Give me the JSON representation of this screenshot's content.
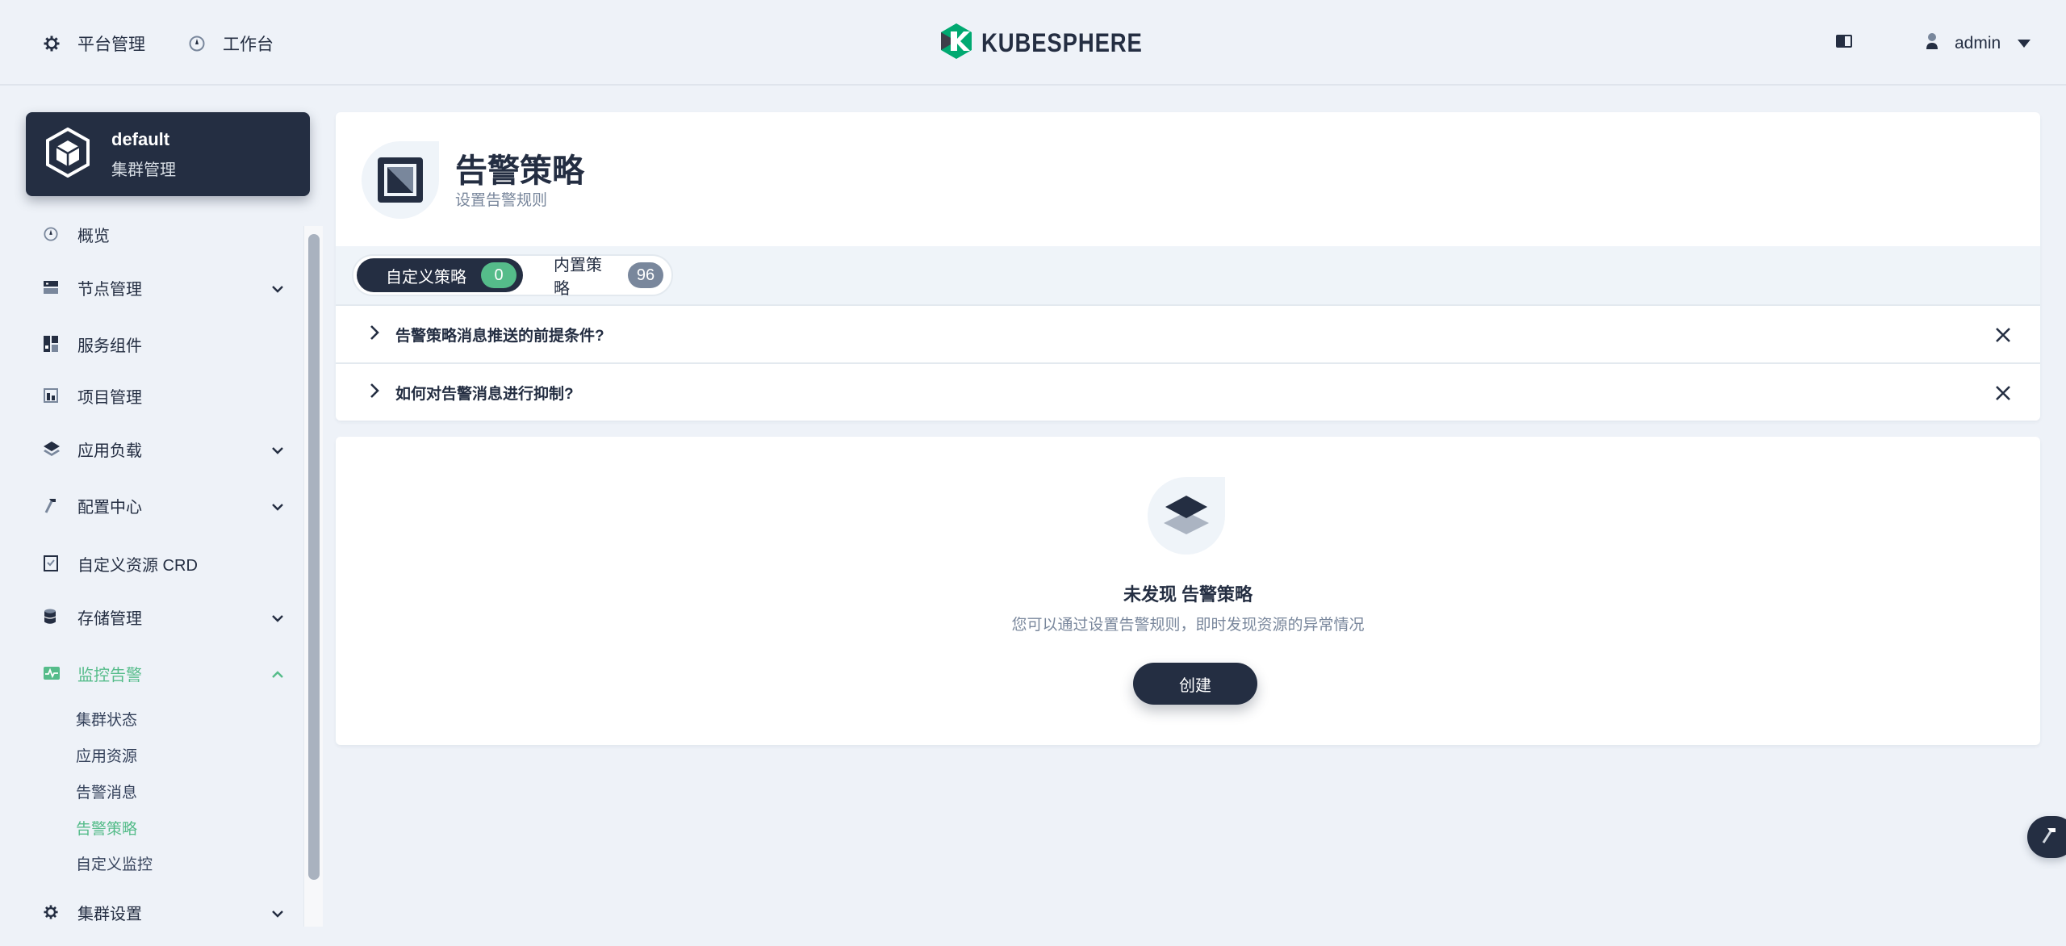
{
  "header": {
    "platform_label": "平台管理",
    "workbench_label": "工作台",
    "brand": "KUBESPHERE",
    "user": "admin"
  },
  "cluster": {
    "name": "default",
    "subtitle": "集群管理"
  },
  "sidebar": {
    "items": [
      {
        "label": "概览"
      },
      {
        "label": "节点管理"
      },
      {
        "label": "服务组件"
      },
      {
        "label": "项目管理"
      },
      {
        "label": "应用负载"
      },
      {
        "label": "配置中心"
      },
      {
        "label": "自定义资源 CRD"
      },
      {
        "label": "存储管理"
      },
      {
        "label": "监控告警"
      },
      {
        "label": "集群设置"
      }
    ],
    "monitoring_sub": [
      {
        "label": "集群状态"
      },
      {
        "label": "应用资源"
      },
      {
        "label": "告警消息"
      },
      {
        "label": "告警策略"
      },
      {
        "label": "自定义监控"
      }
    ]
  },
  "page": {
    "title": "告警策略",
    "description": "设置告警规则"
  },
  "tabs": [
    {
      "label": "自定义策略",
      "count": "0"
    },
    {
      "label": "内置策略",
      "count": "96"
    }
  ],
  "tips": [
    {
      "text": "告警策略消息推送的前提条件?"
    },
    {
      "text": "如何对告警消息进行抑制?"
    }
  ],
  "empty": {
    "title": "未发现 告警策略",
    "description": "您可以通过设置告警规则，即时发现资源的异常情况",
    "create_label": "创建"
  },
  "colors": {
    "primary": "#242e42",
    "accent_green": "#55bc8a",
    "muted": "#79879c",
    "background": "#eef2f8"
  }
}
